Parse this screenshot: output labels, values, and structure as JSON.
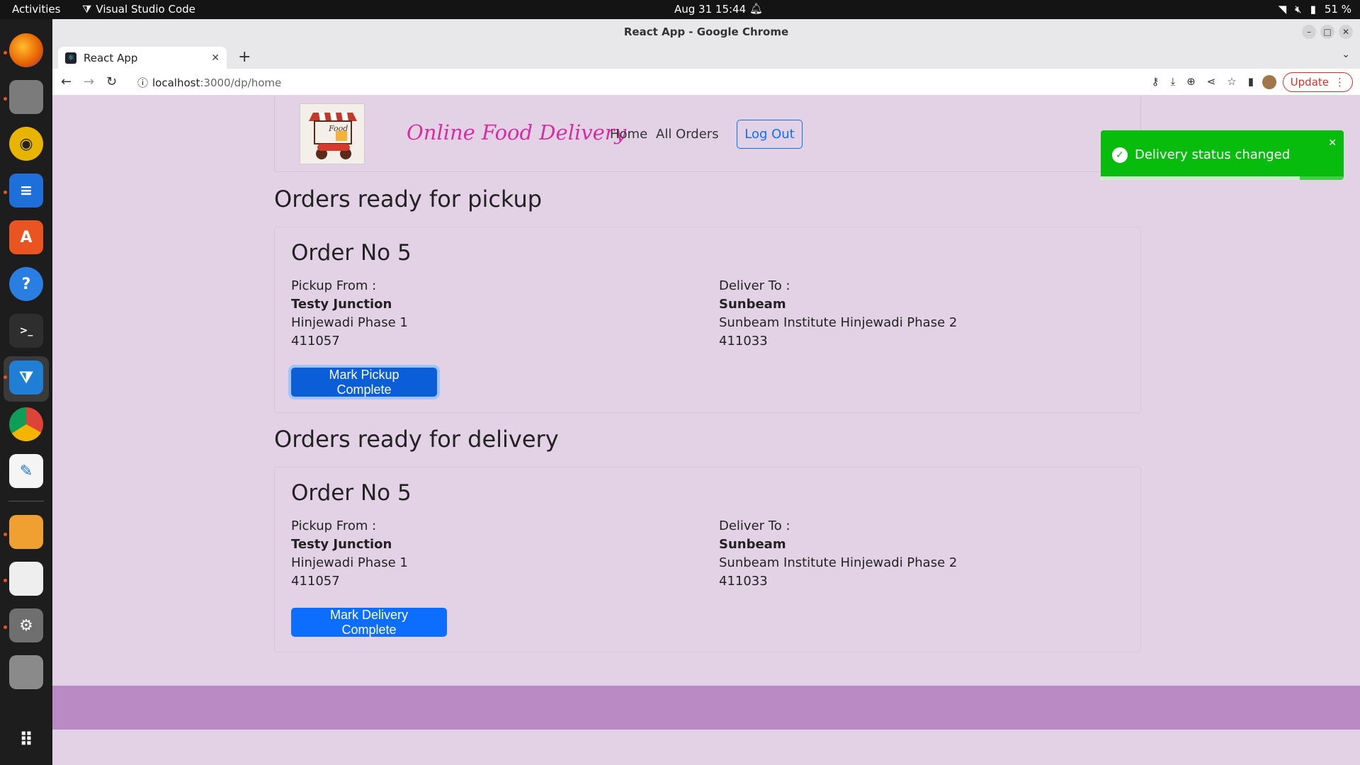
{
  "system": {
    "activities": "Activities",
    "app_name": "Visual Studio Code",
    "clock": "Aug 31  15:44",
    "battery": "51 %"
  },
  "browser": {
    "window_title": "React App - Google Chrome",
    "tab_title": "React App",
    "url_host": "localhost",
    "url_path": ":3000/dp/home",
    "update_label": "Update"
  },
  "navbar": {
    "logo_text": "Food",
    "brand": "Online Food Delivery",
    "links": [
      "Home",
      "All Orders"
    ],
    "logout_label": "Log Out"
  },
  "pickup_section": {
    "title": "Orders ready for pickup",
    "order": {
      "order_no": "Order No 5",
      "pickup_label": "Pickup From :",
      "pickup_name": "Testy Junction",
      "pickup_address": "Hinjewadi Phase 1",
      "pickup_pin": "411057",
      "deliver_label": "Deliver To :",
      "deliver_name": "Sunbeam",
      "deliver_address": "Sunbeam Institute Hinjewadi Phase 2",
      "deliver_pin": "411033",
      "button_label": "Mark Pickup Complete"
    }
  },
  "delivery_section": {
    "title": "Orders ready for delivery",
    "order": {
      "order_no": "Order No 5",
      "pickup_label": "Pickup From :",
      "pickup_name": "Testy Junction",
      "pickup_address": "Hinjewadi Phase 1",
      "pickup_pin": "411057",
      "deliver_label": "Deliver To :",
      "deliver_name": "Sunbeam",
      "deliver_address": "Sunbeam Institute Hinjewadi Phase 2",
      "deliver_pin": "411033",
      "button_label": "Mark Delivery Complete"
    }
  },
  "toast": {
    "message": "Delivery status changed",
    "progress": 0.82
  },
  "colors": {
    "page_bg": "#e3d2e6",
    "footer_bg": "#b98ac3",
    "brand": "#d32f9f",
    "primary": "#0d6efd",
    "toast_bg": "#07bc0c"
  }
}
